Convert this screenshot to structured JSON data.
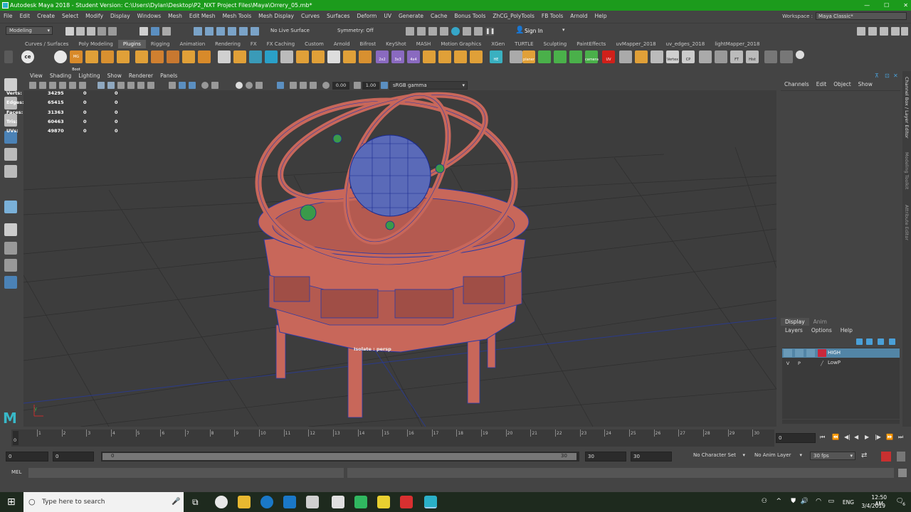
{
  "window": {
    "title": "Autodesk Maya 2018 - Student Version: C:\\Users\\Dylan\\Desktop\\P2_NXT Project Files\\Maya\\Orrery_05.mb*",
    "controls": [
      "—",
      "☐",
      "✕"
    ]
  },
  "menubar": {
    "items": [
      "File",
      "Edit",
      "Create",
      "Select",
      "Modify",
      "Display",
      "Windows",
      "Mesh",
      "Edit Mesh",
      "Mesh Tools",
      "Mesh Display",
      "Curves",
      "Surfaces",
      "Deform",
      "UV",
      "Generate",
      "Cache",
      "Bonus Tools",
      "ZhCG_PolyTools",
      "FB Tools",
      "Arnold",
      "Help"
    ]
  },
  "workspace": {
    "label": "Workspace :",
    "value": "Maya Classic*"
  },
  "statusline": {
    "mode": "Modeling",
    "live_surface": "No Live Surface",
    "symmetry": "Symmetry: Off",
    "sign_in": "Sign In"
  },
  "shelf": {
    "tabs": [
      "Curves / Surfaces",
      "Poly Modeling",
      "Plugins",
      "Rigging",
      "Animation",
      "Rendering",
      "FX",
      "FX Caching",
      "Custom",
      "Arnold",
      "Bifrost",
      "KeyShot",
      "MASH",
      "Motion Graphics",
      "XGen",
      "TURTLE",
      "Sculpting",
      "PaintEffects",
      "uvMapper_2018",
      "uv_edges_2018",
      "lightMapper_2018"
    ],
    "active_tab": "Plugins",
    "icon_labels": [
      "ce",
      "MG Boot",
      "2x2",
      "3x3",
      "4x4",
      "HE",
      "planer",
      "camera",
      "UV",
      "Vertex",
      "CP",
      "FT",
      "Hist"
    ]
  },
  "viewport": {
    "menu": [
      "View",
      "Shading",
      "Lighting",
      "Show",
      "Renderer",
      "Panels"
    ],
    "exposure": "0.00",
    "gamma": "1.00",
    "color_space": "sRGB gamma",
    "isolate_label": "Isolate : persp",
    "hud": [
      {
        "label": "Verts:",
        "v1": "34295",
        "v2": "0",
        "v3": "0"
      },
      {
        "label": "Edges:",
        "v1": "65415",
        "v2": "0",
        "v3": "0"
      },
      {
        "label": "Faces:",
        "v1": "31363",
        "v2": "0",
        "v3": "0"
      },
      {
        "label": "Tris:",
        "v1": "60463",
        "v2": "0",
        "v3": "0"
      },
      {
        "label": "UVs:",
        "v1": "49870",
        "v2": "0",
        "v3": "0"
      }
    ]
  },
  "channel_box": {
    "menu": [
      "Channels",
      "Edit",
      "Object",
      "Show"
    ],
    "side_tabs": [
      "Channel Box / Layer Editor",
      "Modeling Toolkit",
      "Attribute Editor"
    ]
  },
  "layer_editor": {
    "tabs": [
      "Display",
      "Anim"
    ],
    "menu": [
      "Layers",
      "Options",
      "Help"
    ],
    "layers": [
      {
        "v": "",
        "p": "",
        "name": "HIGH",
        "color": "#c8283c",
        "selected": true
      },
      {
        "v": "V",
        "p": "P",
        "name": "LowP",
        "color": "",
        "selected": false
      }
    ]
  },
  "timeline": {
    "ticks": [
      "1",
      "2",
      "3",
      "4",
      "5",
      "6",
      "7",
      "8",
      "9",
      "10",
      "11",
      "12",
      "13",
      "14",
      "15",
      "16",
      "17",
      "18",
      "19",
      "20",
      "21",
      "22",
      "23",
      "24",
      "25",
      "26",
      "27",
      "28",
      "29",
      "30"
    ],
    "current_frame_left": "0",
    "current_frame": "0"
  },
  "range": {
    "start": "0",
    "anim_start": "0",
    "slider_start": "0",
    "slider_end": "30",
    "end": "30",
    "anim_end": "30",
    "character_set": "No Character Set",
    "anim_layer": "No Anim Layer",
    "fps": "30 fps"
  },
  "mel": {
    "label": "MEL"
  },
  "taskbar": {
    "search_placeholder": "Type here to search",
    "language": "ENG",
    "time": "12:50 AM",
    "date": "3/4/2019",
    "notification_count": "6"
  },
  "colors": {
    "title_green": "#1c9b1c",
    "model_salmon": "#c8675a",
    "wire_blue": "#2a3aa8",
    "sphere_blue": "#5a6ab8",
    "planet_green": "#3a9a4a",
    "layer_selected": "#5285a6"
  }
}
